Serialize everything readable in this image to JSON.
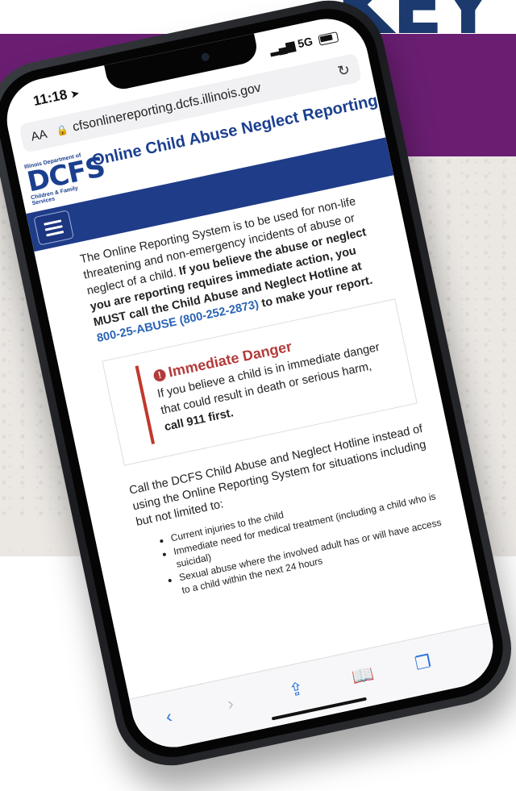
{
  "background": {
    "corner_text": "KEY",
    "band_color": "#6a1e72",
    "paper_color": "#ebe8e4"
  },
  "status_bar": {
    "time": "11:18",
    "location_icon": "location-arrow-icon",
    "network": "5G"
  },
  "browser": {
    "aa_label": "AA",
    "url": "cfsonlinereporting.dcfs.illinois.gov",
    "reload_icon": "reload-icon"
  },
  "site": {
    "logo_top": "Illinois Department of",
    "logo_main": "DCFS",
    "logo_bottom": "Children & Family Services",
    "title": "Online Child Abuse Neglect Reporting"
  },
  "content": {
    "intro_regular": "The Online Reporting System is to be used for non-life threatening and non-emergency incidents of abuse or neglect of a child. ",
    "intro_bold": "If you believe the abuse or neglect you are reporting requires immediate action, you MUST call the Child Abuse and Neglect Hotline at ",
    "hotline_link": "800-25-ABUSE (800-252-2873)",
    "intro_bold_end": " to make your report.",
    "alert": {
      "title": "Immediate Danger",
      "body_regular": "If you believe a child is in immediate danger that could result in death or serious harm, ",
      "body_bold": "call 911 first."
    },
    "para2": "Call the DCFS Child Abuse and Neglect Hotline instead of using the Online Reporting System for situations including but not limited to:",
    "bullets": [
      "Current injuries to the child",
      "Immediate need for medical treatment (including a child who is suicidal)",
      "Sexual abuse where the involved adult has or will have access to a child within the next 24 hours"
    ]
  },
  "toolbar": {
    "back": "‹",
    "forward": "›"
  }
}
